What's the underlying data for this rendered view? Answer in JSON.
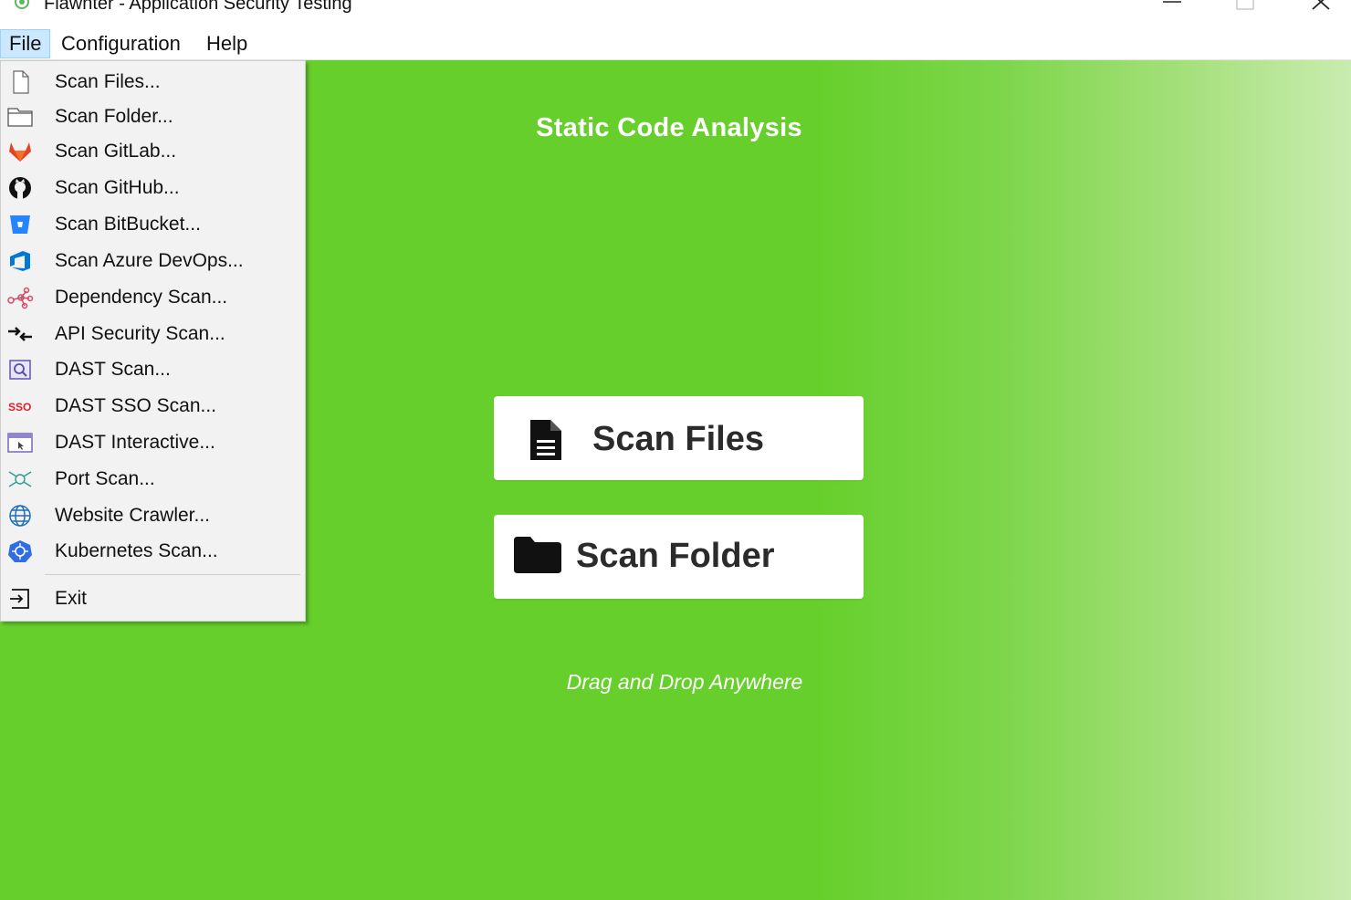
{
  "window": {
    "title": "Flawnter - Application Security Testing",
    "logo_icon": "flawnter-logo-icon"
  },
  "menubar": {
    "items": [
      {
        "label": "File",
        "active": true
      },
      {
        "label": "Configuration",
        "active": false
      },
      {
        "label": "Help",
        "active": false
      }
    ]
  },
  "file_menu": {
    "items": [
      {
        "label": "Scan Files...",
        "icon": "file-icon"
      },
      {
        "label": "Scan Folder...",
        "icon": "folder-icon"
      },
      {
        "label": "Scan GitLab...",
        "icon": "gitlab-icon"
      },
      {
        "label": "Scan GitHub...",
        "icon": "github-icon"
      },
      {
        "label": "Scan BitBucket...",
        "icon": "bitbucket-icon"
      },
      {
        "label": "Scan Azure DevOps...",
        "icon": "azure-devops-icon"
      },
      {
        "label": "Dependency Scan...",
        "icon": "dependency-graph-icon"
      },
      {
        "label": "API Security Scan...",
        "icon": "api-arrows-icon"
      },
      {
        "label": "DAST Scan...",
        "icon": "dast-search-icon"
      },
      {
        "label": "DAST SSO Scan...",
        "icon": "sso-icon"
      },
      {
        "label": "DAST Interactive...",
        "icon": "browser-window-icon"
      },
      {
        "label": "Port Scan...",
        "icon": "network-node-icon"
      },
      {
        "label": "Website Crawler...",
        "icon": "globe-icon"
      },
      {
        "label": "Kubernetes Scan...",
        "icon": "kubernetes-icon"
      }
    ],
    "exit": {
      "label": "Exit",
      "icon": "exit-icon"
    }
  },
  "main": {
    "heading": "Static Code Analysis",
    "scan_files_label": "Scan Files",
    "scan_folder_label": "Scan Folder",
    "drag_drop_text": "Drag and Drop Anywhere"
  },
  "colors": {
    "background_green": "#66cf2b",
    "gradient_end": "#c9ecb0",
    "menu_highlight": "#cce8ff"
  }
}
